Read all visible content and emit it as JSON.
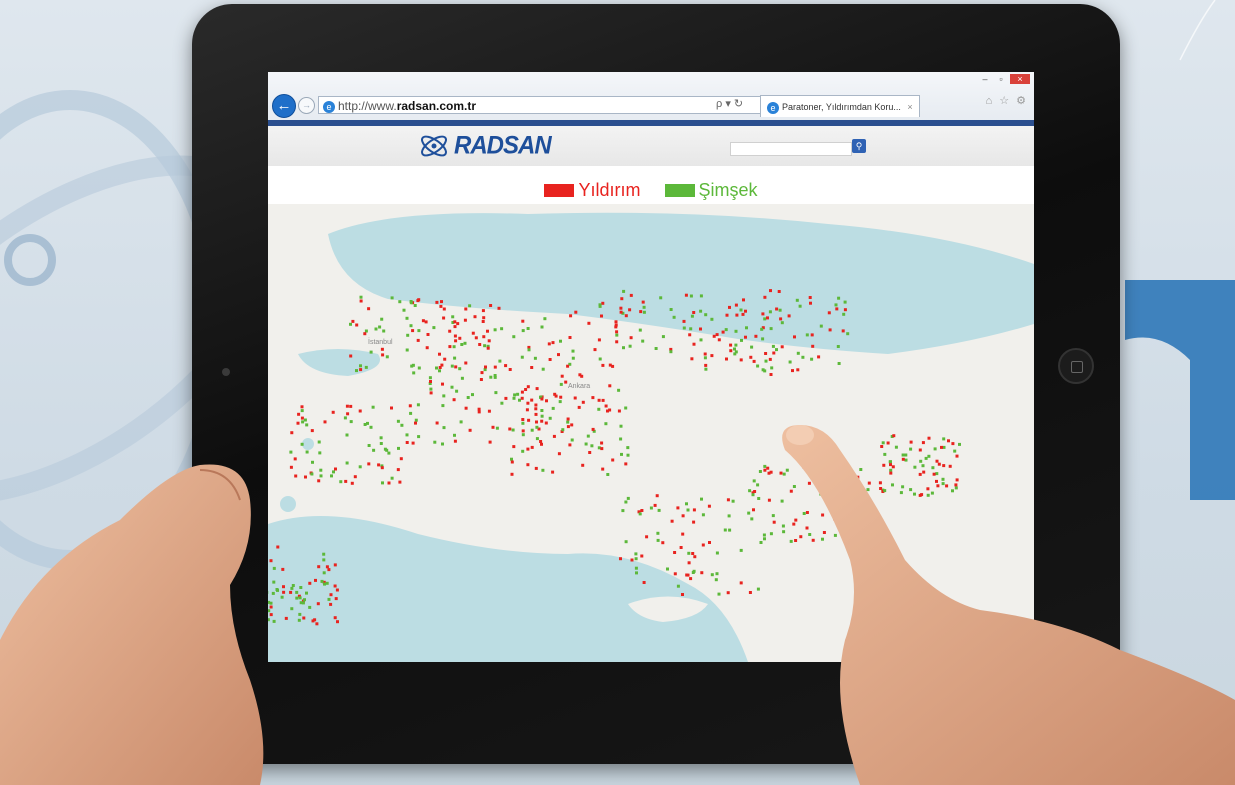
{
  "browser": {
    "url_prefix": "http://www.",
    "url_host": "radsan.com.tr",
    "search_controls": "ρ ▾ ↻",
    "tab_title": "Paratoner, Yıldırımdan Koru...",
    "tab_close": "×",
    "window_controls": [
      "–",
      "▫",
      "×"
    ],
    "toolbar_icons": "⌂ ☆ ⚙"
  },
  "site": {
    "logo_text": "RADSAN",
    "search_button_icon": "search-icon"
  },
  "legend": [
    {
      "label": "Yıldırım",
      "color": "#e8231f"
    },
    {
      "label": "Şimşek",
      "color": "#5cb83a"
    }
  ],
  "map": {
    "city_labels": [
      "İstanbul",
      "Ankara"
    ],
    "sea_color": "#bcdde3",
    "land_color": "#f1f0ec"
  },
  "colors": {
    "lightning": "#e8231f",
    "flash": "#5cb83a",
    "brand": "#1e4f9b"
  }
}
